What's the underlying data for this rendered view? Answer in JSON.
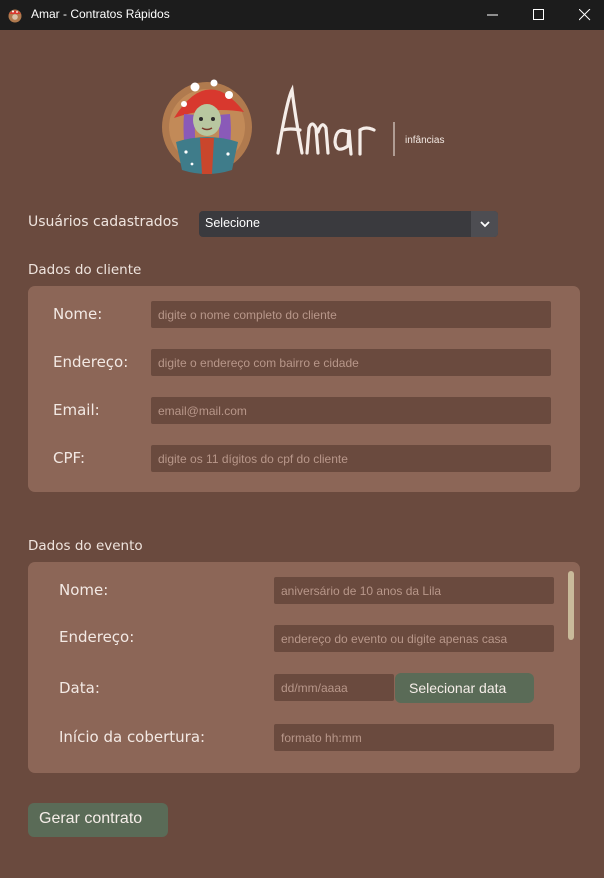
{
  "window": {
    "title": "Amar - Contratos Rápidos"
  },
  "logo": {
    "wordmark": "Amar",
    "subtitle": "infâncias"
  },
  "usuarios": {
    "label": "Usuários cadastrados",
    "selected": "Selecione"
  },
  "cliente": {
    "section_label": "Dados do cliente",
    "fields": [
      {
        "label": "Nome:",
        "placeholder": "digite o nome completo do cliente"
      },
      {
        "label": "Endereço:",
        "placeholder": "digite o endereço com bairro e cidade"
      },
      {
        "label": "Email:",
        "placeholder": "email@mail.com"
      },
      {
        "label": "CPF:",
        "placeholder": "digite os 11 dígitos do cpf do cliente"
      }
    ]
  },
  "evento": {
    "section_label": "Dados do evento",
    "fields": [
      {
        "label": "Nome:",
        "placeholder": "aniversário de 10 anos da Lila"
      },
      {
        "label": "Endereço:",
        "placeholder": "endereço do evento ou digite apenas casa"
      },
      {
        "label": "Data:",
        "placeholder": "dd/mm/aaaa"
      },
      {
        "label": "Início da cobertura:",
        "placeholder": "formato hh:mm"
      }
    ],
    "date_button": "Selecionar data"
  },
  "actions": {
    "generate": "Gerar contrato"
  },
  "colors": {
    "background": "#6a4a3e",
    "panel": "#8c6657",
    "button_green": "#5a6b57"
  }
}
